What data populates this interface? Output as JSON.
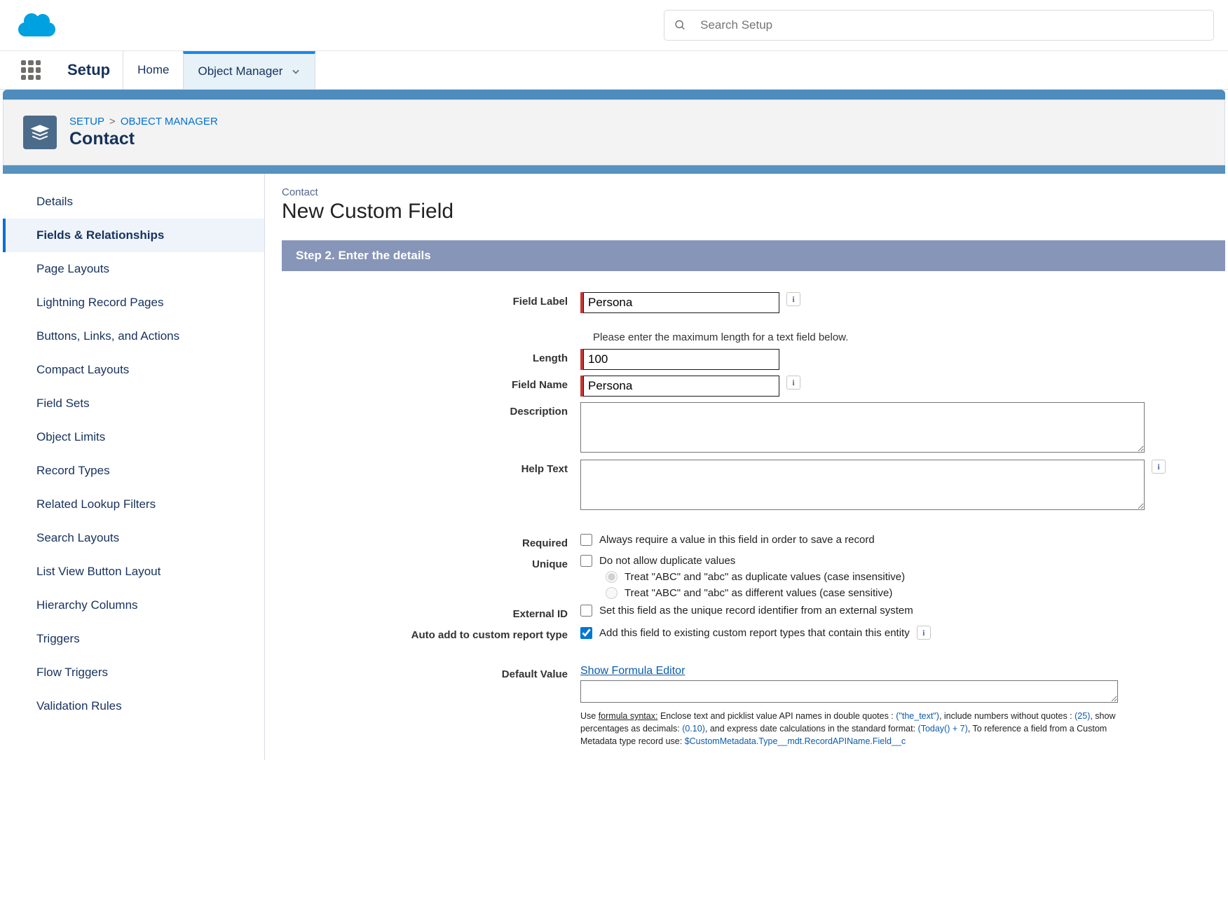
{
  "header": {
    "search_placeholder": "Search Setup"
  },
  "nav": {
    "app_title": "Setup",
    "home": "Home",
    "object_manager": "Object Manager"
  },
  "breadcrumb": {
    "setup": "SETUP",
    "object_manager": "OBJECT MANAGER",
    "title": "Contact"
  },
  "sidebar": {
    "items": [
      {
        "label": "Details"
      },
      {
        "label": "Fields & Relationships"
      },
      {
        "label": "Page Layouts"
      },
      {
        "label": "Lightning Record Pages"
      },
      {
        "label": "Buttons, Links, and Actions"
      },
      {
        "label": "Compact Layouts"
      },
      {
        "label": "Field Sets"
      },
      {
        "label": "Object Limits"
      },
      {
        "label": "Record Types"
      },
      {
        "label": "Related Lookup Filters"
      },
      {
        "label": "Search Layouts"
      },
      {
        "label": "List View Button Layout"
      },
      {
        "label": "Hierarchy Columns"
      },
      {
        "label": "Triggers"
      },
      {
        "label": "Flow Triggers"
      },
      {
        "label": "Validation Rules"
      }
    ]
  },
  "content": {
    "object_name": "Contact",
    "page_title": "New Custom Field",
    "step_header": "Step 2. Enter the details",
    "labels": {
      "field_label": "Field Label",
      "length": "Length",
      "field_name": "Field Name",
      "description": "Description",
      "help_text": "Help Text",
      "required": "Required",
      "unique": "Unique",
      "external_id": "External ID",
      "auto_report": "Auto add to custom report type",
      "default_value": "Default Value"
    },
    "hint_length": "Please enter the maximum length for a text field below.",
    "values": {
      "field_label": "Persona",
      "length": "100",
      "field_name": "Persona",
      "description": "",
      "help_text": "",
      "default_formula": ""
    },
    "checkbox_text": {
      "required": "Always require a value in this field in order to save a record",
      "unique": "Do not allow duplicate values",
      "case_insensitive": "Treat \"ABC\" and \"abc\" as duplicate values (case insensitive)",
      "case_sensitive": "Treat \"ABC\" and \"abc\" as different values (case sensitive)",
      "external_id": "Set this field as the unique record identifier from an external system",
      "auto_report": "Add this field to existing custom report types that contain this entity"
    },
    "default_link": "Show Formula Editor",
    "syntax": {
      "prefix": "Use ",
      "formula_syntax": "formula syntax:",
      "text1": " Enclose text and picklist value API names in double quotes : ",
      "ex1": "(\"the_text\")",
      "text2": ", include numbers without quotes : ",
      "ex2": "(25)",
      "text3": ", show percentages as decimals: ",
      "ex3": "(0.10)",
      "text4": ", and express date calculations in the standard format: ",
      "ex4": "(Today() + 7)",
      "text5": ", To reference a field from a Custom Metadata type record use: ",
      "ex5": "$CustomMetadata.Type__mdt.RecordAPIName.Field__c"
    }
  }
}
